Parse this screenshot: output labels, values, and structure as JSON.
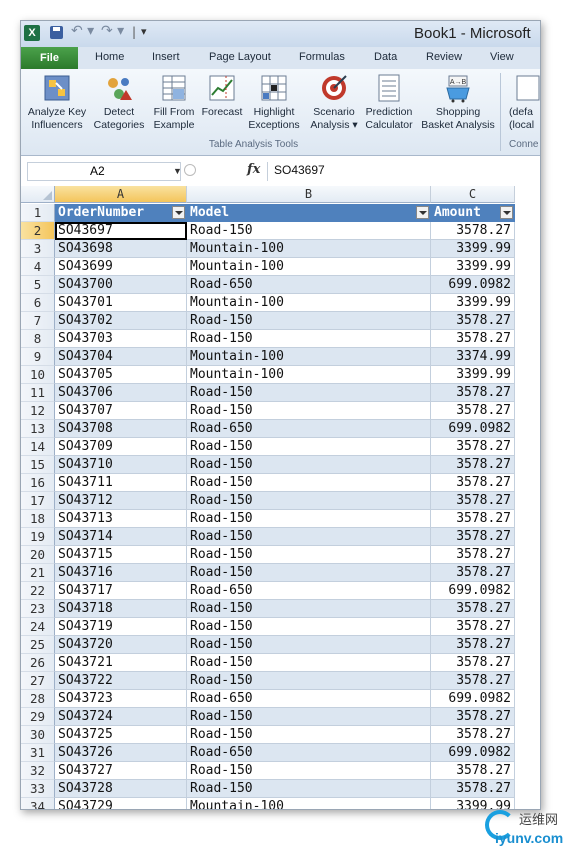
{
  "window": {
    "title": "Book1 - Microsoft"
  },
  "quick_access": {
    "app_icon": "X",
    "save_icon": "save-icon",
    "undo_icon": "undo-icon",
    "redo_icon": "redo-icon"
  },
  "tabs": [
    "File",
    "Home",
    "Insert",
    "Page Layout",
    "Formulas",
    "Data",
    "Review",
    "View"
  ],
  "ribbon": {
    "buttons": [
      {
        "line1": "Analyze Key",
        "line2": "Influencers",
        "icon": "analyze-key-influencers-icon"
      },
      {
        "line1": "Detect",
        "line2": "Categories",
        "icon": "detect-categories-icon"
      },
      {
        "line1": "Fill From",
        "line2": "Example",
        "icon": "fill-from-example-icon"
      },
      {
        "line1": "Forecast",
        "line2": "",
        "icon": "forecast-icon"
      },
      {
        "line1": "Highlight",
        "line2": "Exceptions",
        "icon": "highlight-exceptions-icon"
      },
      {
        "line1": "Scenario",
        "line2": "Analysis ▾",
        "icon": "scenario-analysis-icon"
      },
      {
        "line1": "Prediction",
        "line2": "Calculator",
        "icon": "prediction-calculator-icon"
      },
      {
        "line1": "Shopping",
        "line2": "Basket Analysis",
        "icon": "shopping-basket-icon"
      },
      {
        "line1": "(defa",
        "line2": "(local",
        "icon": "connection-icon"
      }
    ],
    "group_label": "Table Analysis Tools",
    "group2_label": "Conne"
  },
  "formula_bar": {
    "name_box": "A2",
    "fx_label": "fx",
    "value": "SO43697"
  },
  "columns": [
    "A",
    "B",
    "C"
  ],
  "table": {
    "headers": [
      "OrderNumber",
      "Model",
      "Amount"
    ],
    "rows": [
      {
        "n": "2",
        "order": "SO43697",
        "model": "Road-150",
        "amount": "3578.27"
      },
      {
        "n": "3",
        "order": "SO43698",
        "model": "Mountain-100",
        "amount": "3399.99"
      },
      {
        "n": "4",
        "order": "SO43699",
        "model": "Mountain-100",
        "amount": "3399.99"
      },
      {
        "n": "5",
        "order": "SO43700",
        "model": "Road-650",
        "amount": "699.0982"
      },
      {
        "n": "6",
        "order": "SO43701",
        "model": "Mountain-100",
        "amount": "3399.99"
      },
      {
        "n": "7",
        "order": "SO43702",
        "model": "Road-150",
        "amount": "3578.27"
      },
      {
        "n": "8",
        "order": "SO43703",
        "model": "Road-150",
        "amount": "3578.27"
      },
      {
        "n": "9",
        "order": "SO43704",
        "model": "Mountain-100",
        "amount": "3374.99"
      },
      {
        "n": "10",
        "order": "SO43705",
        "model": "Mountain-100",
        "amount": "3399.99"
      },
      {
        "n": "11",
        "order": "SO43706",
        "model": "Road-150",
        "amount": "3578.27"
      },
      {
        "n": "12",
        "order": "SO43707",
        "model": "Road-150",
        "amount": "3578.27"
      },
      {
        "n": "13",
        "order": "SO43708",
        "model": "Road-650",
        "amount": "699.0982"
      },
      {
        "n": "14",
        "order": "SO43709",
        "model": "Road-150",
        "amount": "3578.27"
      },
      {
        "n": "15",
        "order": "SO43710",
        "model": "Road-150",
        "amount": "3578.27"
      },
      {
        "n": "16",
        "order": "SO43711",
        "model": "Road-150",
        "amount": "3578.27"
      },
      {
        "n": "17",
        "order": "SO43712",
        "model": "Road-150",
        "amount": "3578.27"
      },
      {
        "n": "18",
        "order": "SO43713",
        "model": "Road-150",
        "amount": "3578.27"
      },
      {
        "n": "19",
        "order": "SO43714",
        "model": "Road-150",
        "amount": "3578.27"
      },
      {
        "n": "20",
        "order": "SO43715",
        "model": "Road-150",
        "amount": "3578.27"
      },
      {
        "n": "21",
        "order": "SO43716",
        "model": "Road-150",
        "amount": "3578.27"
      },
      {
        "n": "22",
        "order": "SO43717",
        "model": "Road-650",
        "amount": "699.0982"
      },
      {
        "n": "23",
        "order": "SO43718",
        "model": "Road-150",
        "amount": "3578.27"
      },
      {
        "n": "24",
        "order": "SO43719",
        "model": "Road-150",
        "amount": "3578.27"
      },
      {
        "n": "25",
        "order": "SO43720",
        "model": "Road-150",
        "amount": "3578.27"
      },
      {
        "n": "26",
        "order": "SO43721",
        "model": "Road-150",
        "amount": "3578.27"
      },
      {
        "n": "27",
        "order": "SO43722",
        "model": "Road-150",
        "amount": "3578.27"
      },
      {
        "n": "28",
        "order": "SO43723",
        "model": "Road-650",
        "amount": "699.0982"
      },
      {
        "n": "29",
        "order": "SO43724",
        "model": "Road-150",
        "amount": "3578.27"
      },
      {
        "n": "30",
        "order": "SO43725",
        "model": "Road-150",
        "amount": "3578.27"
      },
      {
        "n": "31",
        "order": "SO43726",
        "model": "Road-650",
        "amount": "699.0982"
      },
      {
        "n": "32",
        "order": "SO43727",
        "model": "Road-150",
        "amount": "3578.27"
      },
      {
        "n": "33",
        "order": "SO43728",
        "model": "Road-150",
        "amount": "3578.27"
      },
      {
        "n": "34",
        "order": "SO43729",
        "model": "Mountain-100",
        "amount": "3399.99"
      }
    ]
  },
  "watermark": {
    "cn": "运维网",
    "url": "iyunv.com"
  }
}
